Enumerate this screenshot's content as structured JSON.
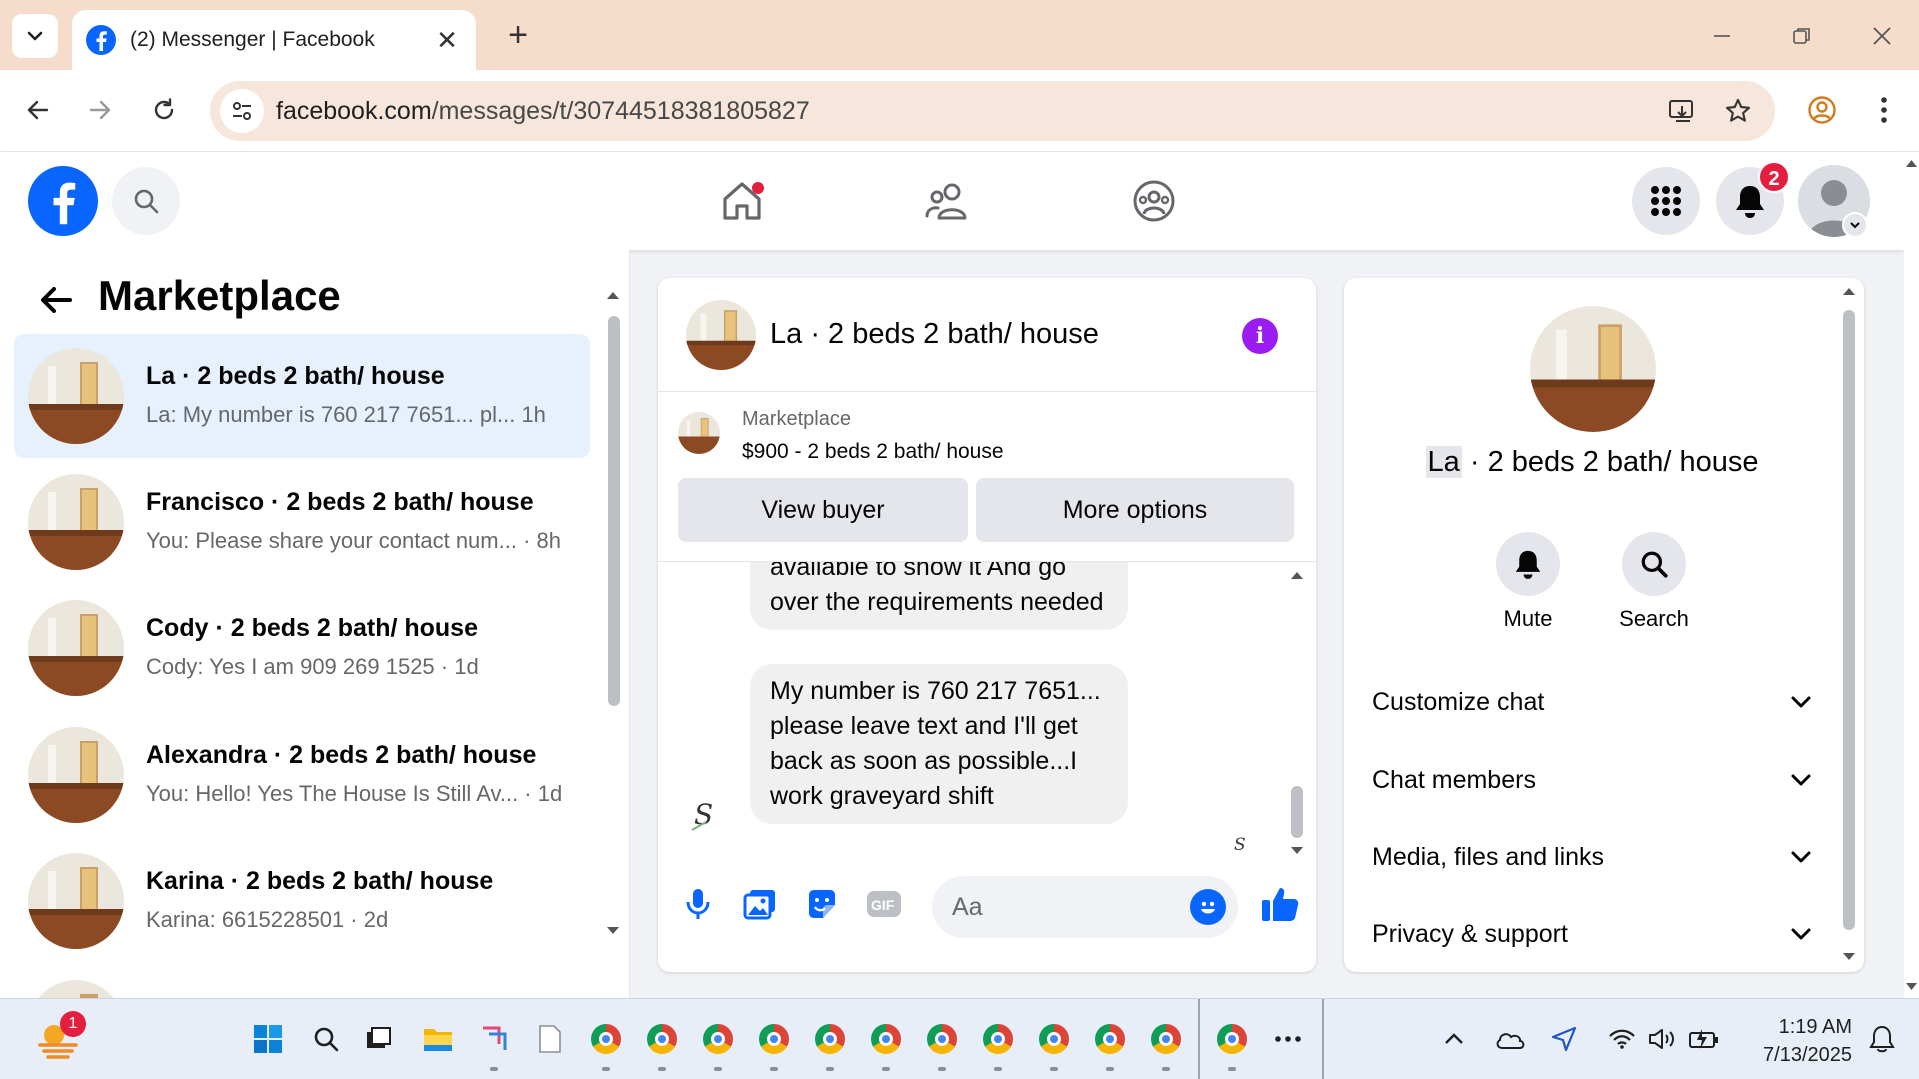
{
  "browser": {
    "tab_title": "(2) Messenger | Facebook",
    "url_host": "facebook.com",
    "url_path": "/messages/t/30744518381805827"
  },
  "fb_header": {
    "notification_count": "2"
  },
  "left_panel": {
    "title": "Marketplace",
    "conversations": [
      {
        "name": "La · 2 beds 2 bath/ house",
        "preview": "La: My number is 760 217 7651... pl...  1h"
      },
      {
        "name": "Francisco · 2 beds 2 bath/ house",
        "preview": "You: Please share your contact num... · 8h"
      },
      {
        "name": "Cody · 2 beds 2 bath/ house",
        "preview": "Cody: Yes I am 909 269 1525 · 1d"
      },
      {
        "name": "Alexandra · 2 beds 2 bath/ house",
        "preview": "You: Hello! Yes The House Is Still Av... · 1d"
      },
      {
        "name": "Karina · 2 beds 2 bath/ house",
        "preview": "Karina: 6615228501 · 2d"
      }
    ]
  },
  "chat": {
    "title": "La · 2 beds 2 bath/ house",
    "marketplace_label": "Marketplace",
    "listing": "$900 - 2 beds 2 bath/ house",
    "view_buyer_label": "View buyer",
    "more_options_label": "More options",
    "messages": [
      "available to show it And go over the requirements needed",
      "My number is 760 217 7651... please leave text and I'll get back as soon as possible...I work graveyard shift"
    ],
    "input_placeholder": "Aa"
  },
  "info_panel": {
    "title_name": "La",
    "title_rest": " · 2 beds 2 bath/ house",
    "mute_label": "Mute",
    "search_label": "Search",
    "sections": [
      "Customize chat",
      "Chat members",
      "Media, files and links",
      "Privacy & support"
    ]
  },
  "taskbar": {
    "time": "1:19 AM",
    "date": "7/13/2025",
    "weather_badge": "1"
  },
  "colors": {
    "facebook_blue": "#0866ff",
    "active_conversation": "#e7f0fd",
    "notification_red": "#e41e3f",
    "info_purple": "#9b1cf0"
  }
}
